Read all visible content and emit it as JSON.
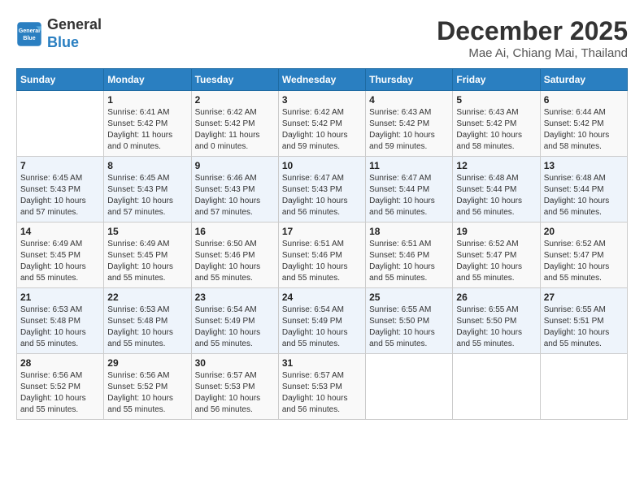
{
  "logo": {
    "line1": "General",
    "line2": "Blue"
  },
  "title": "December 2025",
  "subtitle": "Mae Ai, Chiang Mai, Thailand",
  "headers": [
    "Sunday",
    "Monday",
    "Tuesday",
    "Wednesday",
    "Thursday",
    "Friday",
    "Saturday"
  ],
  "weeks": [
    [
      {
        "day": "",
        "info": ""
      },
      {
        "day": "1",
        "info": "Sunrise: 6:41 AM\nSunset: 5:42 PM\nDaylight: 11 hours\nand 0 minutes."
      },
      {
        "day": "2",
        "info": "Sunrise: 6:42 AM\nSunset: 5:42 PM\nDaylight: 11 hours\nand 0 minutes."
      },
      {
        "day": "3",
        "info": "Sunrise: 6:42 AM\nSunset: 5:42 PM\nDaylight: 10 hours\nand 59 minutes."
      },
      {
        "day": "4",
        "info": "Sunrise: 6:43 AM\nSunset: 5:42 PM\nDaylight: 10 hours\nand 59 minutes."
      },
      {
        "day": "5",
        "info": "Sunrise: 6:43 AM\nSunset: 5:42 PM\nDaylight: 10 hours\nand 58 minutes."
      },
      {
        "day": "6",
        "info": "Sunrise: 6:44 AM\nSunset: 5:42 PM\nDaylight: 10 hours\nand 58 minutes."
      }
    ],
    [
      {
        "day": "7",
        "info": "Sunrise: 6:45 AM\nSunset: 5:43 PM\nDaylight: 10 hours\nand 57 minutes."
      },
      {
        "day": "8",
        "info": "Sunrise: 6:45 AM\nSunset: 5:43 PM\nDaylight: 10 hours\nand 57 minutes."
      },
      {
        "day": "9",
        "info": "Sunrise: 6:46 AM\nSunset: 5:43 PM\nDaylight: 10 hours\nand 57 minutes."
      },
      {
        "day": "10",
        "info": "Sunrise: 6:47 AM\nSunset: 5:43 PM\nDaylight: 10 hours\nand 56 minutes."
      },
      {
        "day": "11",
        "info": "Sunrise: 6:47 AM\nSunset: 5:44 PM\nDaylight: 10 hours\nand 56 minutes."
      },
      {
        "day": "12",
        "info": "Sunrise: 6:48 AM\nSunset: 5:44 PM\nDaylight: 10 hours\nand 56 minutes."
      },
      {
        "day": "13",
        "info": "Sunrise: 6:48 AM\nSunset: 5:44 PM\nDaylight: 10 hours\nand 56 minutes."
      }
    ],
    [
      {
        "day": "14",
        "info": "Sunrise: 6:49 AM\nSunset: 5:45 PM\nDaylight: 10 hours\nand 55 minutes."
      },
      {
        "day": "15",
        "info": "Sunrise: 6:49 AM\nSunset: 5:45 PM\nDaylight: 10 hours\nand 55 minutes."
      },
      {
        "day": "16",
        "info": "Sunrise: 6:50 AM\nSunset: 5:46 PM\nDaylight: 10 hours\nand 55 minutes."
      },
      {
        "day": "17",
        "info": "Sunrise: 6:51 AM\nSunset: 5:46 PM\nDaylight: 10 hours\nand 55 minutes."
      },
      {
        "day": "18",
        "info": "Sunrise: 6:51 AM\nSunset: 5:46 PM\nDaylight: 10 hours\nand 55 minutes."
      },
      {
        "day": "19",
        "info": "Sunrise: 6:52 AM\nSunset: 5:47 PM\nDaylight: 10 hours\nand 55 minutes."
      },
      {
        "day": "20",
        "info": "Sunrise: 6:52 AM\nSunset: 5:47 PM\nDaylight: 10 hours\nand 55 minutes."
      }
    ],
    [
      {
        "day": "21",
        "info": "Sunrise: 6:53 AM\nSunset: 5:48 PM\nDaylight: 10 hours\nand 55 minutes."
      },
      {
        "day": "22",
        "info": "Sunrise: 6:53 AM\nSunset: 5:48 PM\nDaylight: 10 hours\nand 55 minutes."
      },
      {
        "day": "23",
        "info": "Sunrise: 6:54 AM\nSunset: 5:49 PM\nDaylight: 10 hours\nand 55 minutes."
      },
      {
        "day": "24",
        "info": "Sunrise: 6:54 AM\nSunset: 5:49 PM\nDaylight: 10 hours\nand 55 minutes."
      },
      {
        "day": "25",
        "info": "Sunrise: 6:55 AM\nSunset: 5:50 PM\nDaylight: 10 hours\nand 55 minutes."
      },
      {
        "day": "26",
        "info": "Sunrise: 6:55 AM\nSunset: 5:50 PM\nDaylight: 10 hours\nand 55 minutes."
      },
      {
        "day": "27",
        "info": "Sunrise: 6:55 AM\nSunset: 5:51 PM\nDaylight: 10 hours\nand 55 minutes."
      }
    ],
    [
      {
        "day": "28",
        "info": "Sunrise: 6:56 AM\nSunset: 5:52 PM\nDaylight: 10 hours\nand 55 minutes."
      },
      {
        "day": "29",
        "info": "Sunrise: 6:56 AM\nSunset: 5:52 PM\nDaylight: 10 hours\nand 55 minutes."
      },
      {
        "day": "30",
        "info": "Sunrise: 6:57 AM\nSunset: 5:53 PM\nDaylight: 10 hours\nand 56 minutes."
      },
      {
        "day": "31",
        "info": "Sunrise: 6:57 AM\nSunset: 5:53 PM\nDaylight: 10 hours\nand 56 minutes."
      },
      {
        "day": "",
        "info": ""
      },
      {
        "day": "",
        "info": ""
      },
      {
        "day": "",
        "info": ""
      }
    ]
  ]
}
